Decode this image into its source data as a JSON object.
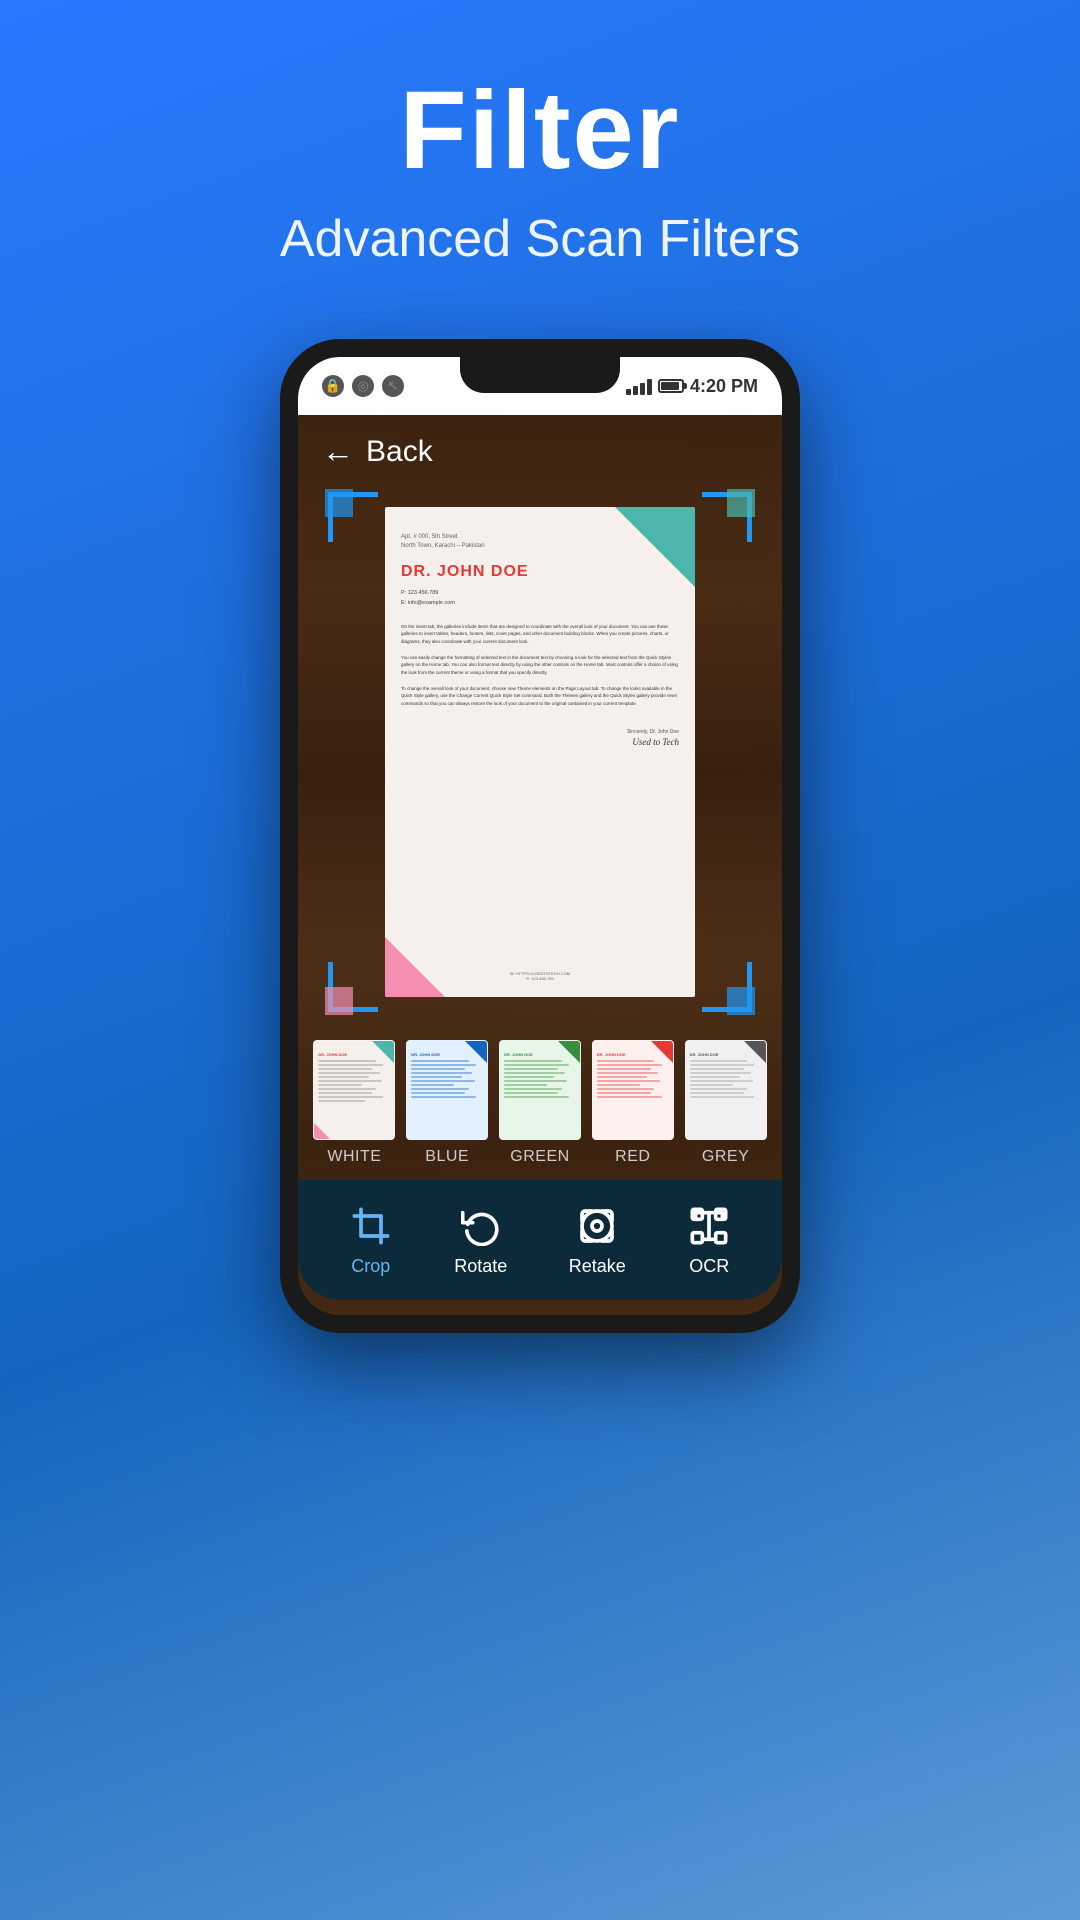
{
  "header": {
    "title": "Filter",
    "subtitle": "Advanced Scan Filters"
  },
  "status_bar": {
    "time": "4:20 PM"
  },
  "back_button": {
    "label": "Back"
  },
  "document": {
    "address": "Apt. # 000, 5th Street\nNorth Town, Karachi – Pakistan",
    "name": "DR. JOHN DOE",
    "phone": "P: 123.456.789",
    "email": "E: info@example.com",
    "body1": "On the insert tab, the galleries include items that are designed to coordinate with the overall look of your document. You can use these galleries to insert tables, headers, footers, lists, cover pages, and other document building blocks. When you create pictures, charts, or diagrams, they also coordinate with your current document look.",
    "body2": "You can easily change the formatting of selected text in the document text by choosing a look for the selected text from the Quick Styles gallery on the Home tab. You can also format text directly by using the other controls on the Home tab. Most controls offer a choice of using the look from the current theme or using a format that you specify directly.",
    "body3": "To change the overall look of your document, choose new Theme elements on the Page Layout tab. To change the looks available in the Quick Style gallery, use the Change Current Quick Style Set command. Both the Themes gallery and the Quick Styles gallery provide reset commands so that you can always restore the look of your document to the original contained in your current template.",
    "closing": "Sincerely,\nDr. John Doe",
    "signature": "Used to Tech",
    "footer": "W: HTTPS://USEDTOTECH.COM\nP: 123.456.789"
  },
  "filters": [
    {
      "label": "WHITE",
      "color": "#f5f0eb",
      "accent": "#4db6ac",
      "nameColor": "#e53935",
      "lineColor": "#888888"
    },
    {
      "label": "BLUE",
      "color": "#e3f0ff",
      "accent": "#1565c0",
      "nameColor": "#1565c0",
      "lineColor": "#1565c0"
    },
    {
      "label": "GREEN",
      "color": "#e8f5e9",
      "accent": "#388e3c",
      "nameColor": "#388e3c",
      "lineColor": "#388e3c"
    },
    {
      "label": "RED",
      "color": "#fff0f0",
      "accent": "#e53935",
      "nameColor": "#e53935",
      "lineColor": "#e53935"
    },
    {
      "label": "GREY",
      "color": "#f0f0f0",
      "accent": "#555555",
      "nameColor": "#555",
      "lineColor": "#999"
    }
  ],
  "toolbar": {
    "buttons": [
      {
        "label": "Crop",
        "icon": "crop",
        "active": true
      },
      {
        "label": "Rotate",
        "icon": "rotate",
        "active": false
      },
      {
        "label": "Retake",
        "icon": "retake",
        "active": false
      },
      {
        "label": "OCR",
        "icon": "ocr",
        "active": false
      }
    ]
  }
}
